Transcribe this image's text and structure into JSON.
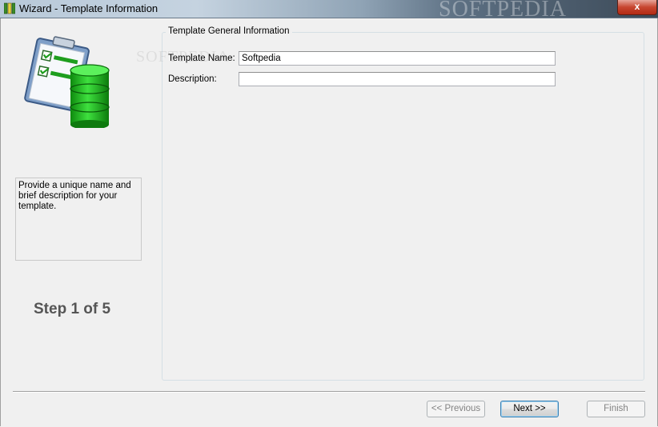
{
  "window": {
    "title": "Wizard - Template Information",
    "close_label": "x",
    "watermark": "SOFTPEDIA"
  },
  "sidebar": {
    "illustration_icon": "clipboard-database-icon",
    "help_text": "Provide a unique name and brief description for your template.",
    "step_text": "Step 1 of 5"
  },
  "group": {
    "legend": "Template General Information",
    "name_label": "Template Name:",
    "name_value": "Softpedia",
    "description_label": "Description:",
    "description_value": ""
  },
  "buttons": {
    "previous": "<< Previous",
    "next": "Next >>",
    "finish": "Finish"
  },
  "colors": {
    "accent_green": "#22c322",
    "checkbox_green": "#1e9e1e"
  }
}
